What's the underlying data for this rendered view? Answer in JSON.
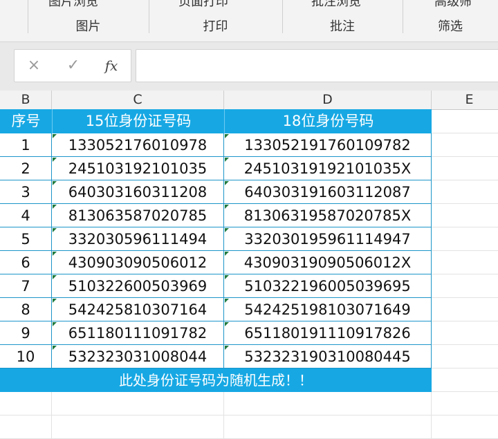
{
  "ribbon": {
    "top_clipped": [
      "图片浏览",
      "页面打印",
      "批注浏览",
      "高级筛"
    ],
    "groups": [
      "图片",
      "打印",
      "批注",
      "筛选"
    ]
  },
  "formula_bar": {
    "cancel_icon": "×",
    "enter_icon": "✓",
    "fx_label": "fx",
    "value": ""
  },
  "columns": [
    "B",
    "C",
    "D",
    "E"
  ],
  "table": {
    "headers": [
      "序号",
      "15位身份证号码",
      "18位身份号码"
    ],
    "rows": [
      [
        "1",
        "133052176010978",
        "133052191760109782"
      ],
      [
        "2",
        "245103192101035",
        "2451031919210103 5X"
      ],
      [
        "3",
        "640303160311208",
        "640303191603112087"
      ],
      [
        "4",
        "813063587020785",
        "81306319587020785X"
      ],
      [
        "5",
        "332030596111494",
        "332030195961114947"
      ],
      [
        "6",
        "430903090506012",
        "43090319090506012X"
      ],
      [
        "7",
        "510322600503969",
        "510322196005039695"
      ],
      [
        "8",
        "542425810307164",
        "542425198103071649"
      ],
      [
        "9",
        "651180111091782",
        "651180191110917826"
      ],
      [
        "10",
        "532323031008044",
        "532323190310080445"
      ]
    ],
    "note": "此处身份证号码为随机生成！！"
  },
  "colors": {
    "header_fill": "#17a8e4",
    "cell_border": "#1b95c9",
    "error_triangle": "#1f7a3f"
  }
}
